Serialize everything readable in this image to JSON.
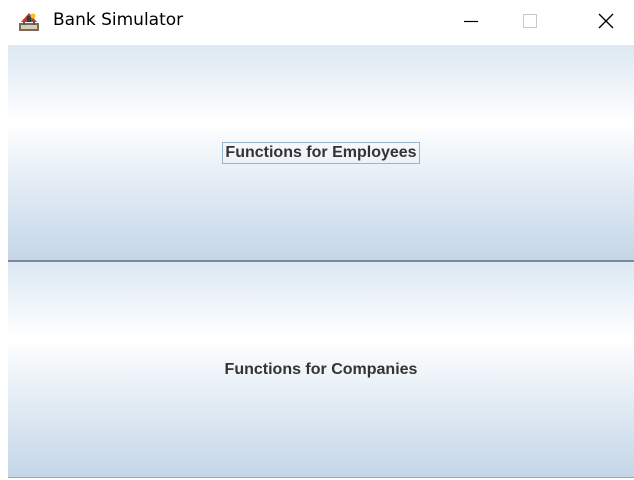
{
  "window": {
    "title": "Bank Simulator",
    "icon": "bank-simulator-app-icon",
    "controls": {
      "minimize_icon": "minimize-icon",
      "maximize_icon": "maximize-icon",
      "close_icon": "close-icon",
      "maximize_disabled": true
    }
  },
  "main": {
    "buttons": [
      {
        "label": "Functions for Employees",
        "focused": true
      },
      {
        "label": "Functions for Companies",
        "focused": false
      }
    ]
  },
  "colors": {
    "button_gradient_top": "#dce8f3",
    "button_gradient_highlight": "#ffffff",
    "button_gradient_bottom": "#c4d6e8",
    "focus_border": "#99b4d1",
    "label_text": "#333333"
  }
}
